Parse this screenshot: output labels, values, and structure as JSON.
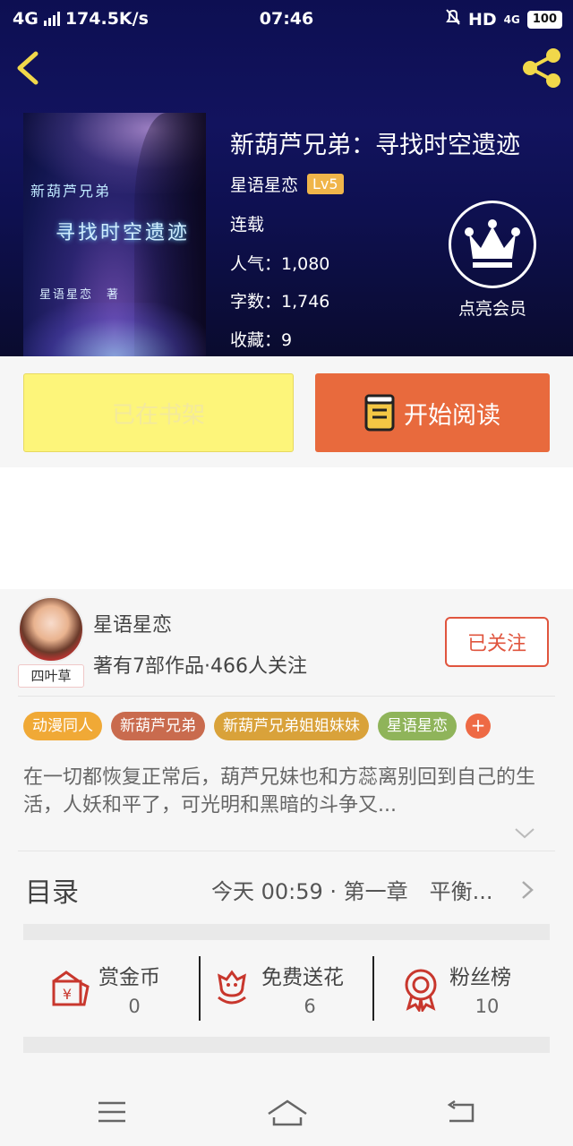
{
  "status_bar": {
    "network": "4G",
    "speed": "174.5K/s",
    "time": "07:46",
    "hd": "HD",
    "net2": "4G",
    "battery": "100"
  },
  "book": {
    "title": "新葫芦兄弟：寻找时空遗迹",
    "author": "星语星恋",
    "level": "Lv5",
    "status": "连载",
    "popularity": "人气：1,080",
    "word_count": "字数：1,746",
    "favorites": "收藏：9",
    "cover": {
      "series": "新葫芦兄弟",
      "subtitle": "寻找时空遗迹",
      "byline": "星语星恋　著"
    }
  },
  "vip": {
    "label": "点亮会员"
  },
  "actions": {
    "shelf_label": "已在书架",
    "read_label": "开始阅读"
  },
  "author_card": {
    "name": "星语星恋",
    "stats": "著有7部作品·466人关注",
    "badge": "四叶草",
    "follow_label": "已关注"
  },
  "tags": [
    {
      "label": "动漫同人",
      "color": "#f0a936"
    },
    {
      "label": "新葫芦兄弟",
      "color": "#c96b4e"
    },
    {
      "label": "新葫芦兄弟姐姐妹妹",
      "color": "#d9a23a"
    },
    {
      "label": "星语星恋",
      "color": "#8fb45a"
    }
  ],
  "tag_more": "+",
  "synopsis": "在一切都恢复正常后，葫芦兄妹也和方蕊离别回到自己的生活，人妖和平了，可光明和黑暗的斗争又...",
  "catalog": {
    "title": "目录",
    "latest": "今天 00:59 · 第一章　平衡..."
  },
  "stats": [
    {
      "label": "赏金币",
      "value": "0",
      "icon": "reward-coin-icon"
    },
    {
      "label": "免费送花",
      "value": "6",
      "icon": "flower-icon"
    },
    {
      "label": "粉丝榜",
      "value": "10",
      "icon": "medal-icon"
    }
  ],
  "colors": {
    "accent": "#e86a3d",
    "shelf_bg": "#fdf57a",
    "follow": "#e0553e",
    "hero_bg": "#12135e",
    "icon_red": "#c8372d"
  }
}
